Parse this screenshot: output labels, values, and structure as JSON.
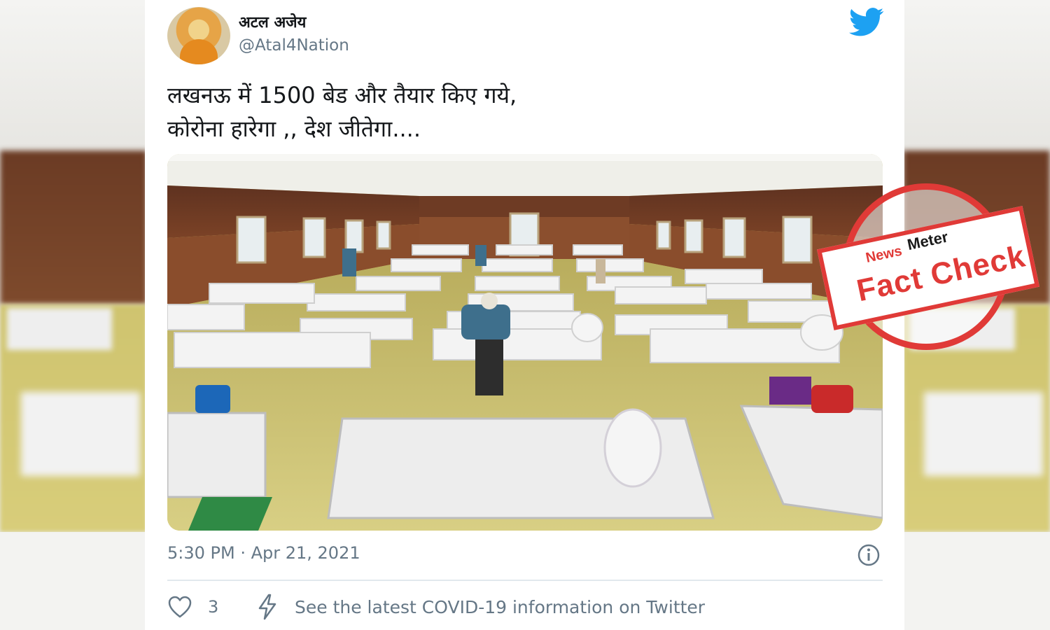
{
  "tweet": {
    "display_name": "अटल अजेय",
    "handle": "@Atal4Nation",
    "text_line1": "लखनऊ में 1500 बेड और तैयार किए गये,",
    "text_line2": "कोरोना हारेगा ,, देश जीतेगा....",
    "timestamp": "5:30 PM · Apr 21, 2021",
    "like_count": "3",
    "covid_info": "See the latest COVID-19 information on Twitter"
  },
  "stamp": {
    "news": "News",
    "meter": "Meter",
    "fact_check": "Fact Check"
  },
  "icons": {
    "brand": "twitter-bird-icon",
    "info": "info-icon",
    "like": "heart-icon",
    "covid": "lightning-bolt-icon"
  },
  "colors": {
    "twitter_blue": "#1da1f2",
    "text_primary": "#14171a",
    "text_secondary": "#657786",
    "stamp_red": "#e03a37"
  }
}
